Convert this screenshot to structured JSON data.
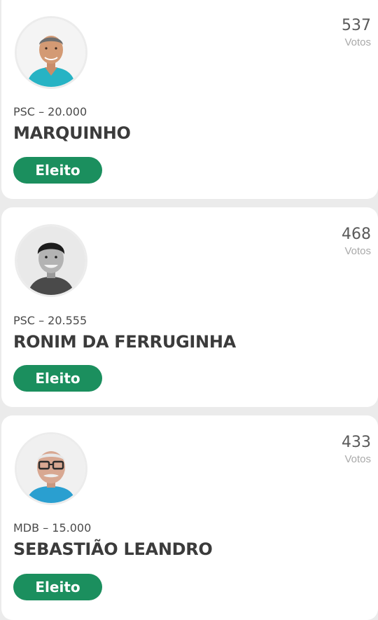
{
  "colors": {
    "page_background": "#ebebeb",
    "card_background": "#ffffff",
    "status_green": "#1b8f5e",
    "votes_label": "#a9a9a9",
    "name_text": "#3b3b3b"
  },
  "candidates": [
    {
      "party_number": "PSC – 20.000",
      "name": "MARQUINHO",
      "votes": "537",
      "votes_label": "Votos",
      "status": "Eleito",
      "avatar_icon": "candidate-photo"
    },
    {
      "party_number": "PSC – 20.555",
      "name": "RONIM DA FERRUGINHA",
      "votes": "468",
      "votes_label": "Votos",
      "status": "Eleito",
      "avatar_icon": "candidate-photo"
    },
    {
      "party_number": "MDB – 15.000",
      "name": "SEBASTIÃO LEANDRO",
      "votes": "433",
      "votes_label": "Votos",
      "status": "Eleito",
      "avatar_icon": "candidate-photo"
    }
  ]
}
